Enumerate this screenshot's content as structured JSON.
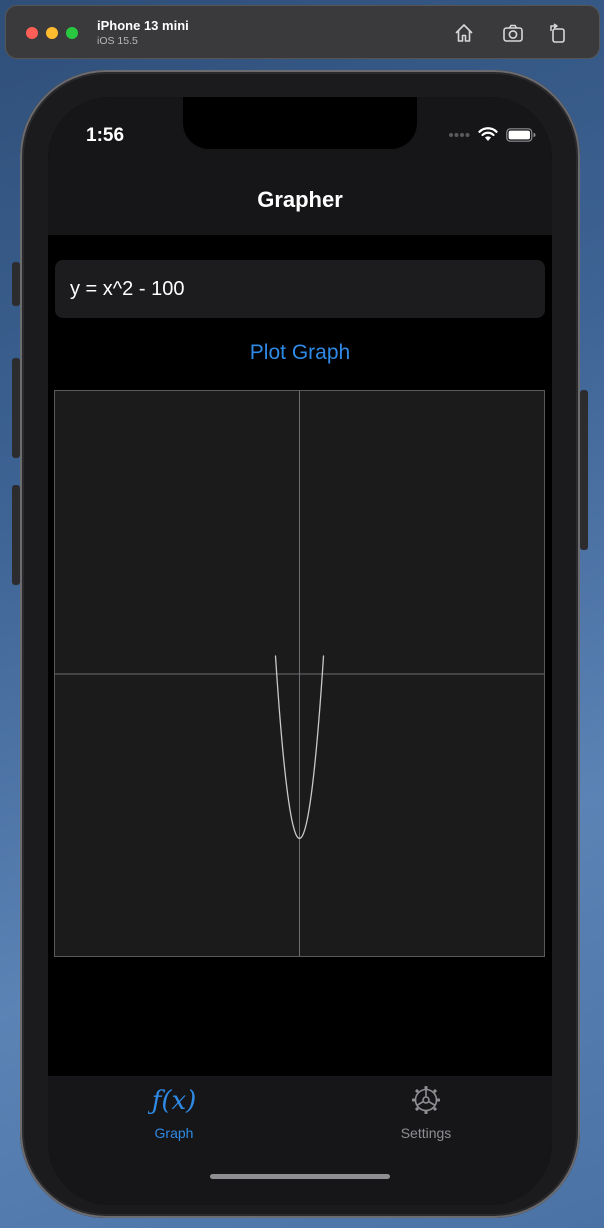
{
  "simulator": {
    "device_name": "iPhone 13 mini",
    "os_version": "iOS 15.5",
    "buttons": [
      "home-icon",
      "screenshot-icon",
      "rotate-icon"
    ]
  },
  "status_bar": {
    "time": "1:56"
  },
  "nav": {
    "title": "Grapher"
  },
  "equation_input": {
    "value": "y = x^2 - 100"
  },
  "plot_button": {
    "label": "Plot Graph"
  },
  "graph": {
    "function": "x^2 - 100"
  },
  "tabbar": {
    "tabs": [
      {
        "label": "Graph",
        "icon": "fx-icon",
        "selected": true
      },
      {
        "label": "Settings",
        "icon": "gear-icon",
        "selected": false
      }
    ]
  },
  "colors": {
    "accent": "#2f8ae6",
    "inactive": "#8e8e93",
    "curve": "#c8c8c8",
    "axis": "#6e6e72"
  }
}
